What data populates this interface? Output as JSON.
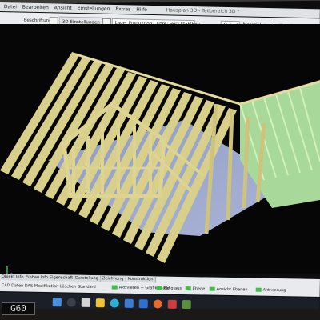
{
  "app": {
    "window_title": "Hausplan 3D - Teilbereich 3D *"
  },
  "menu": {
    "items": [
      "Datei",
      "Bearbeiten",
      "Ansicht",
      "Einstellungen",
      "Extras",
      "Hilfe"
    ]
  },
  "toolbar": {
    "labeling_label": "Beschriftung",
    "settings_3d_label": "3D-Einstellungen",
    "position_label": "Lage: Produktion",
    "material_label": "Ebre: Holz Stahlbau",
    "value_label": "Holz: II",
    "material_flag": "Material: anbesstimmt"
  },
  "colors": {
    "timber": "#d8cf8a",
    "timber_dark": "#b5ab62",
    "timber_green": "#b8e3a0",
    "floor": "#9aa6c8",
    "viewport_bg": "#060607",
    "accent_green": "#3fbf4a"
  },
  "statusbar": {
    "tabs": [
      "Objekt Info",
      "Einbau Info",
      "Eigenschaft",
      "Darstellung",
      "Zeichnung",
      "Konstruktion"
    ],
    "left_text": "CAD Daten   DAS Modifikation   Löschen   Standard",
    "hints": [
      "Aktivieren  + GrafikObjekt",
      "Fang aus",
      "Ebene",
      "Ansicht Ebenen",
      "Aktivierung"
    ]
  },
  "taskbar": {
    "icons": [
      "windows-icon",
      "search-icon",
      "task-view-icon",
      "file-explorer-icon",
      "edge-icon",
      "store-icon",
      "mail-icon",
      "firefox-icon",
      "app-icon",
      "cad-icon"
    ]
  },
  "badge": {
    "text": "G60"
  }
}
